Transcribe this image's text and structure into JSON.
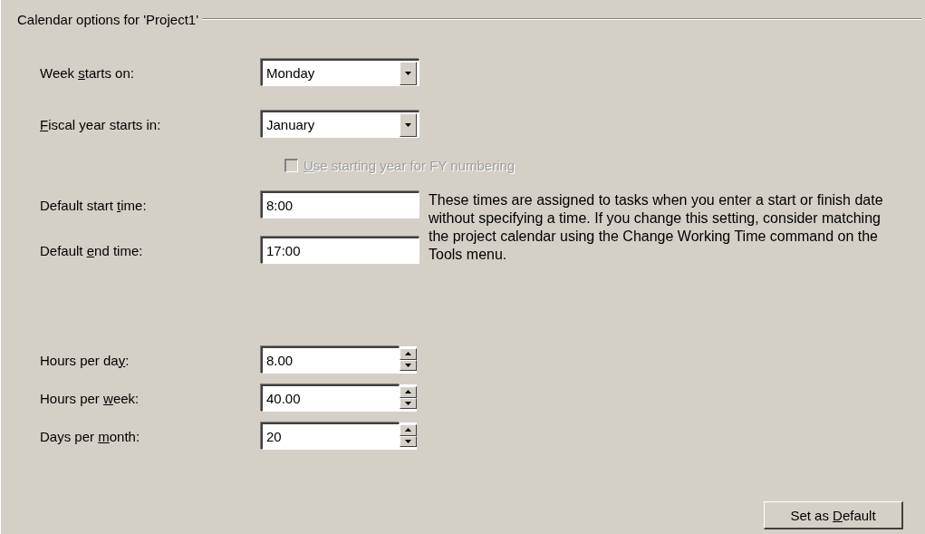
{
  "group_title": "Calendar options for 'Project1'",
  "dropdowns": [
    {
      "label": {
        "before": "Week ",
        "key": "s",
        "after": "tarts on:"
      },
      "value": "Monday"
    },
    {
      "label": {
        "key": "F",
        "after": "iscal year starts in:"
      },
      "value": "January"
    }
  ],
  "checkbox": {
    "label": {
      "key": "U",
      "after": "se starting year for FY numbering"
    },
    "checked": false,
    "disabled": true
  },
  "time_fields": [
    {
      "label": {
        "before": "Default start ",
        "key": "t",
        "after": "ime:"
      },
      "value": "8:00"
    },
    {
      "label": {
        "before": "Default ",
        "key": "e",
        "after": "nd time:"
      },
      "value": "17:00"
    }
  ],
  "note": "These times are assigned to tasks when you enter a start or finish date without specifying a time. If you change this setting, consider matching the project calendar using the Change Working Time command on the Tools menu.",
  "spinners": [
    {
      "label": {
        "before": "Hours per da",
        "key": "y",
        "after": ":"
      },
      "value": "8.00"
    },
    {
      "label": {
        "before": "Hours per ",
        "key": "w",
        "after": "eek:"
      },
      "value": "40.00"
    },
    {
      "label": {
        "before": "Days per ",
        "key": "m",
        "after": "onth:"
      },
      "value": "20"
    }
  ],
  "button": {
    "label": {
      "before": "Set as ",
      "key": "D",
      "after": "efault"
    }
  }
}
